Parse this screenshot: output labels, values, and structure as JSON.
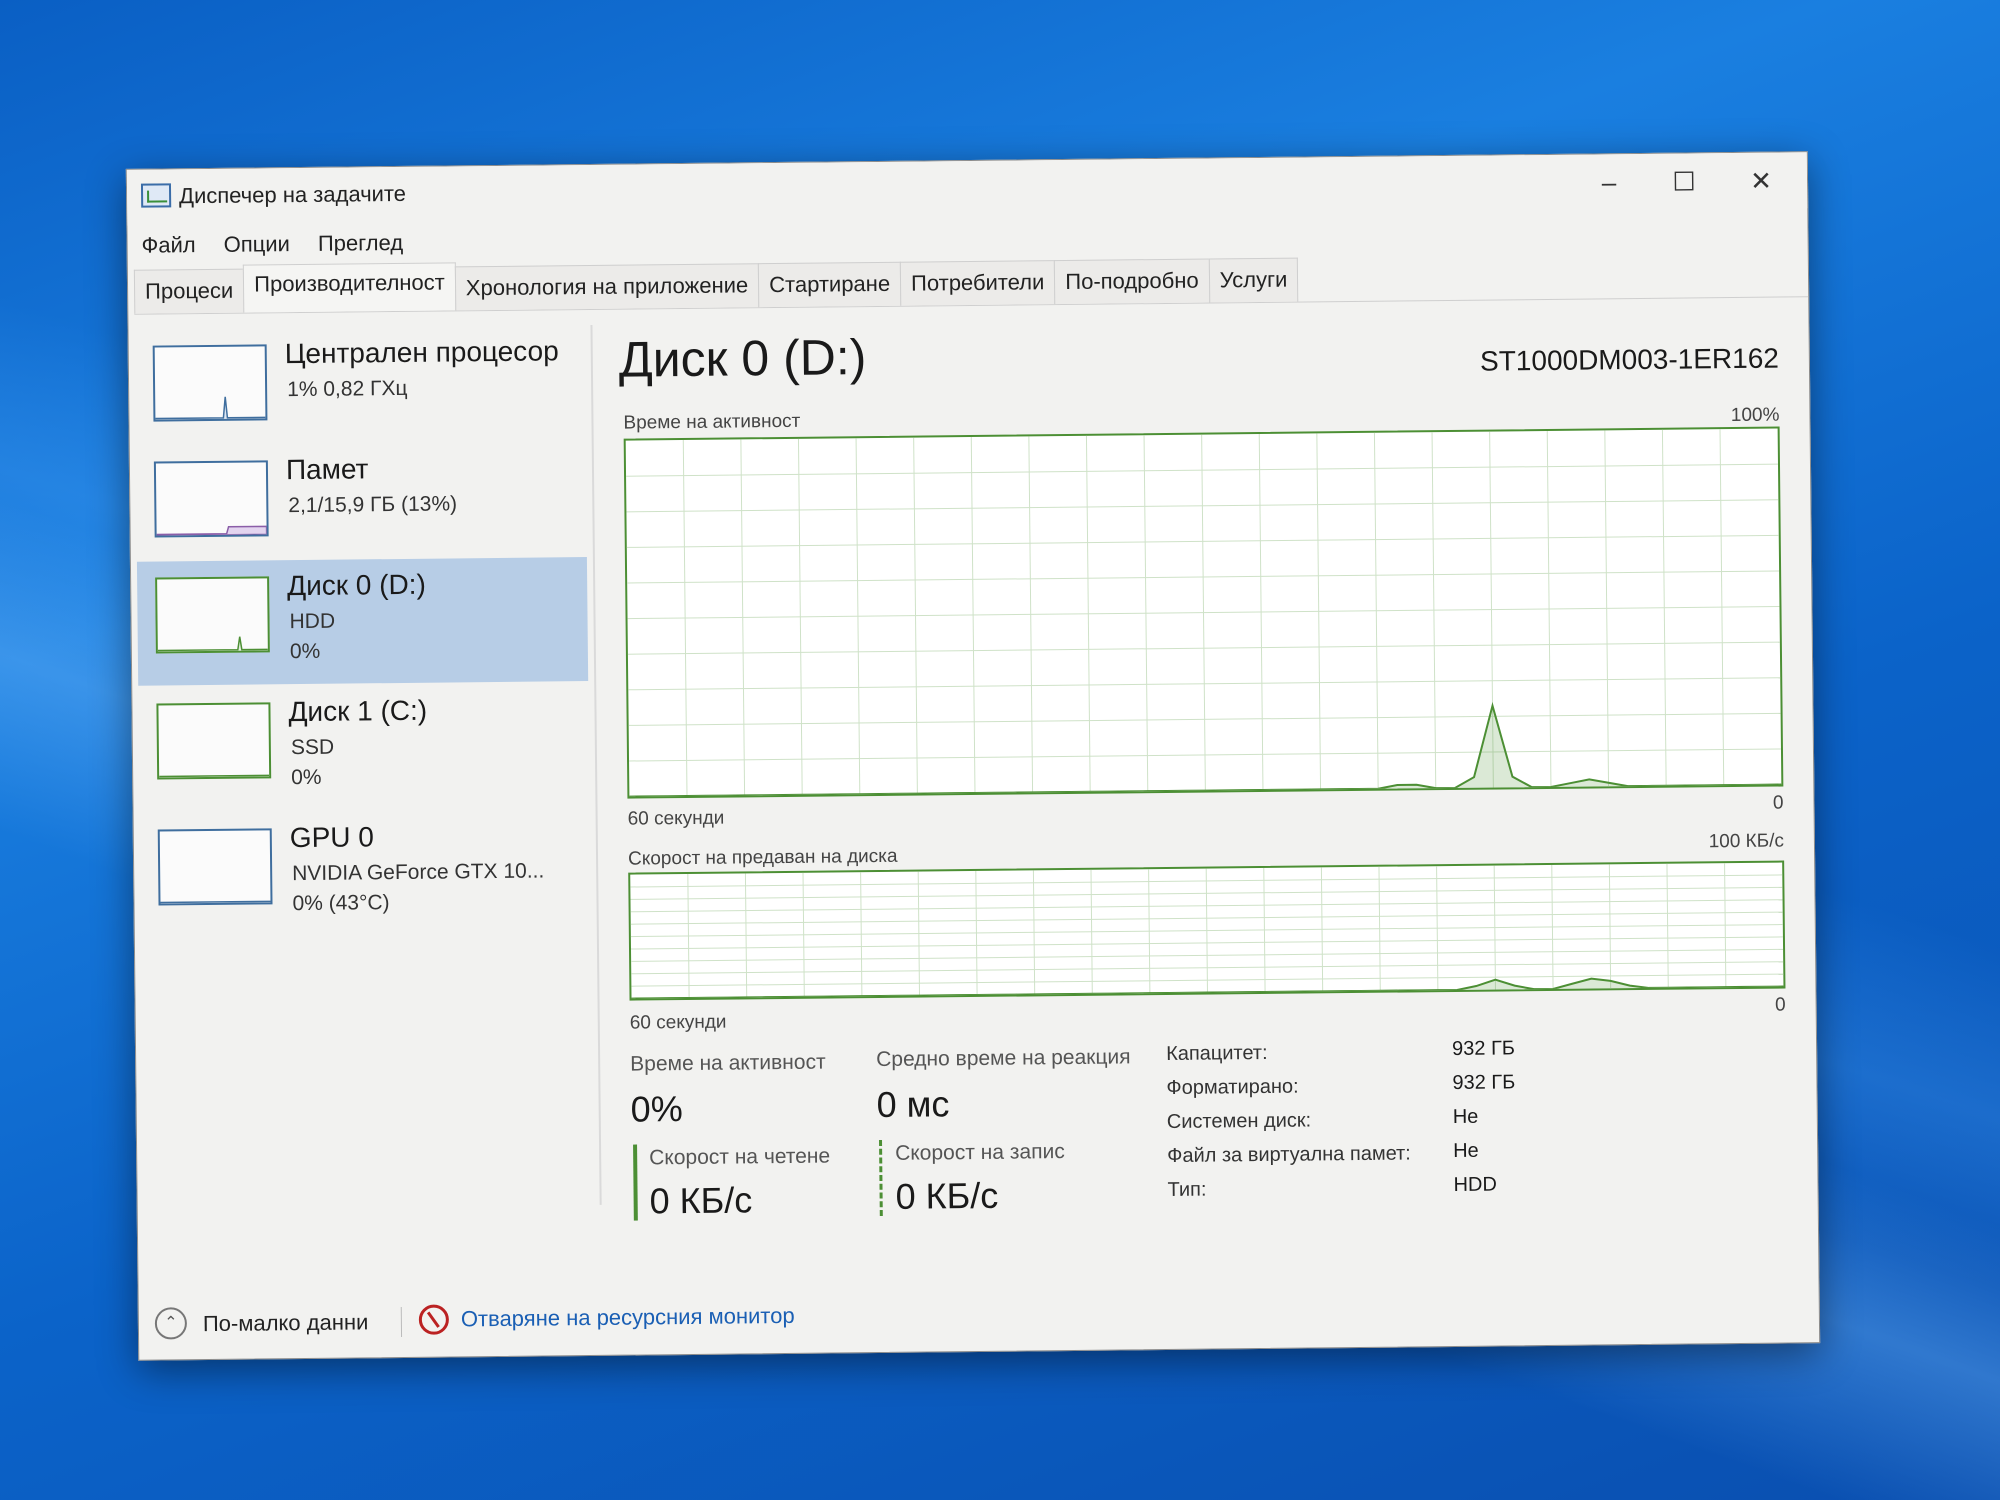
{
  "window": {
    "title": "Диспечер на задачите",
    "controls": {
      "minimize": "–",
      "maximize": "☐",
      "close": "✕"
    }
  },
  "menu": [
    "Файл",
    "Опции",
    "Преглед"
  ],
  "tabs": [
    {
      "label": "Процеси",
      "active": false
    },
    {
      "label": "Производителност",
      "active": true
    },
    {
      "label": "Хронология на приложение",
      "active": false
    },
    {
      "label": "Стартиране",
      "active": false
    },
    {
      "label": "Потребители",
      "active": false
    },
    {
      "label": "По-подробно",
      "active": false
    },
    {
      "label": "Услуги",
      "active": false
    }
  ],
  "sidebar": [
    {
      "name": "Централен процесор",
      "sub1": "1% 0,82 ГХц",
      "sub2": "",
      "selected": false
    },
    {
      "name": "Памет",
      "sub1": "2,1/15,9 ГБ (13%)",
      "sub2": "",
      "selected": false
    },
    {
      "name": "Диск 0 (D:)",
      "sub1": "HDD",
      "sub2": "0%",
      "selected": true
    },
    {
      "name": "Диск 1 (C:)",
      "sub1": "SSD",
      "sub2": "0%",
      "selected": false
    },
    {
      "name": "GPU 0",
      "sub1": "NVIDIA GeForce GTX 10...",
      "sub2": "0% (43°C)",
      "selected": false
    }
  ],
  "main": {
    "title": "Диск 0 (D:)",
    "model": "ST1000DM003-1ER162",
    "chart1": {
      "label": "Време на активност",
      "max": "100%",
      "min": "0",
      "time": "60 секунди"
    },
    "chart2": {
      "label": "Скорост на предаван на диска",
      "max": "100 КБ/с",
      "min": "0",
      "time": "60 секунди"
    }
  },
  "stats": {
    "active_label": "Време на активност",
    "active_value": "0%",
    "response_label": "Средно време на реакция",
    "response_value": "0 мс",
    "read_label": "Скорост на четене",
    "read_value": "0 КБ/с",
    "write_label": "Скорост на запис",
    "write_value": "0 КБ/с"
  },
  "properties": [
    {
      "label": "Капацитет:",
      "value": "932 ГБ"
    },
    {
      "label": "Форматирано:",
      "value": "932 ГБ"
    },
    {
      "label": "Системен диск:",
      "value": "Не"
    },
    {
      "label": "Файл за виртуална памет:",
      "value": "Не"
    },
    {
      "label": "Тип:",
      "value": "HDD"
    }
  ],
  "footer": {
    "fewer_label": "По-малко данни",
    "monitor_label": "Отваряне на ресурсния монитор"
  },
  "chart_data": [
    {
      "type": "area",
      "title": "Време на активност",
      "ylabel": "",
      "xlabel": "60 секунди",
      "ylim": [
        0,
        100
      ],
      "x": [
        0,
        1,
        2,
        3,
        4,
        5,
        6,
        7,
        8,
        9,
        10,
        11,
        12,
        13,
        14,
        15,
        16,
        17,
        18,
        19,
        20,
        21,
        22,
        23,
        24,
        25,
        26,
        27,
        28,
        29,
        30,
        31,
        32,
        33,
        34,
        35,
        36,
        37,
        38,
        39,
        40,
        41,
        42,
        43,
        44,
        45,
        46,
        47,
        48,
        49,
        50,
        51,
        52,
        53,
        54,
        55,
        56,
        57,
        58,
        59,
        60
      ],
      "series": [
        {
          "values": [
            0,
            0,
            0,
            0,
            0,
            0,
            0,
            0,
            0,
            0,
            0,
            0,
            0,
            0,
            0,
            0,
            0,
            0,
            0,
            0,
            0,
            0,
            0,
            0,
            0,
            0,
            0,
            0,
            0,
            0,
            0,
            0,
            0,
            0,
            0,
            0,
            0,
            0,
            0,
            0,
            1,
            1,
            0,
            0,
            3,
            23,
            3,
            0,
            0,
            1,
            2,
            1,
            0,
            0,
            0,
            0,
            0,
            0,
            0,
            0,
            0
          ]
        }
      ],
      "grid": true,
      "color": "#4c8f34"
    },
    {
      "type": "area",
      "title": "Скорост на предаван на диска",
      "ylabel": "",
      "xlabel": "60 секунди",
      "ylim": [
        0,
        100
      ],
      "x": [
        0,
        1,
        2,
        3,
        4,
        5,
        6,
        7,
        8,
        9,
        10,
        11,
        12,
        13,
        14,
        15,
        16,
        17,
        18,
        19,
        20,
        21,
        22,
        23,
        24,
        25,
        26,
        27,
        28,
        29,
        30,
        31,
        32,
        33,
        34,
        35,
        36,
        37,
        38,
        39,
        40,
        41,
        42,
        43,
        44,
        45,
        46,
        47,
        48,
        49,
        50,
        51,
        52,
        53,
        54,
        55,
        56,
        57,
        58,
        59,
        60
      ],
      "series": [
        {
          "values": [
            0,
            0,
            0,
            0,
            0,
            0,
            0,
            0,
            0,
            0,
            0,
            0,
            0,
            0,
            0,
            0,
            0,
            0,
            0,
            0,
            0,
            0,
            0,
            0,
            0,
            0,
            0,
            0,
            0,
            0,
            0,
            0,
            0,
            0,
            0,
            0,
            0,
            0,
            0,
            0,
            0,
            0,
            0,
            0,
            3,
            8,
            3,
            0,
            0,
            4,
            8,
            6,
            2,
            0,
            0,
            0,
            0,
            0,
            0,
            0,
            0
          ]
        }
      ],
      "grid": true,
      "color": "#4c8f34"
    }
  ]
}
